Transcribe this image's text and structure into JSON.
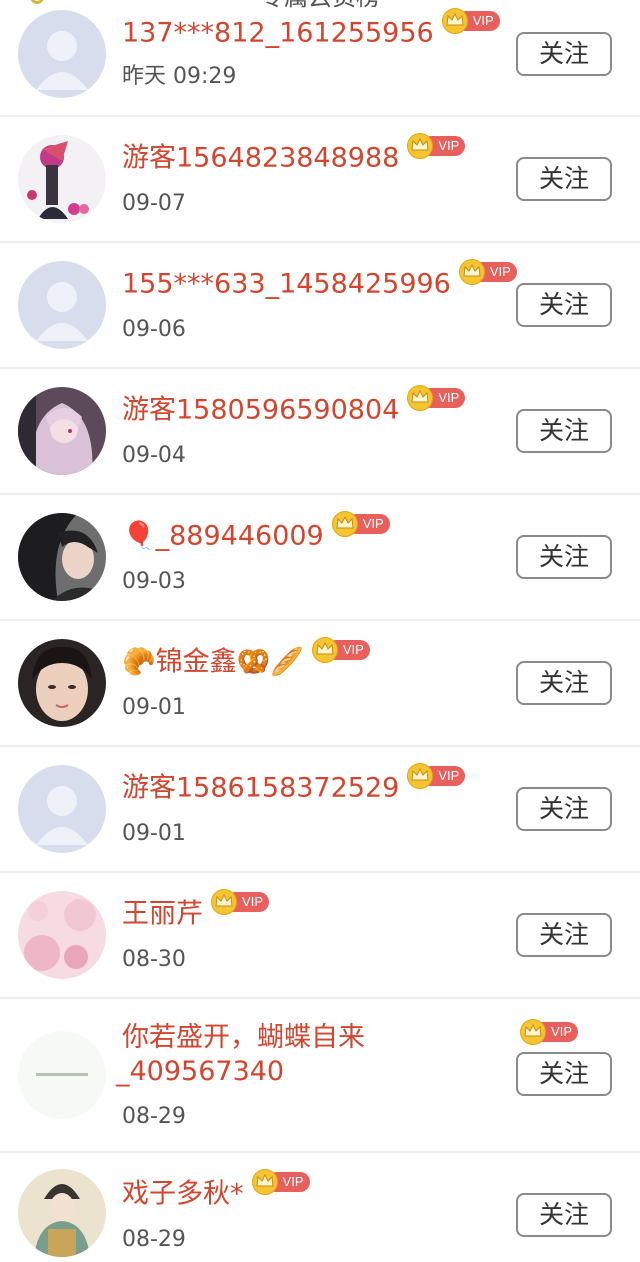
{
  "header": {
    "title": "专属云贡榜"
  },
  "follow_label": "关注",
  "vip_label": "VIP",
  "users": [
    {
      "name": "137***812_161255956",
      "date": "昨天 09:29",
      "avatar": "default-avatar"
    },
    {
      "name": "游客1564823848988",
      "date": "09-07",
      "avatar": "costume-character-avatar"
    },
    {
      "name": "155***633_1458425996",
      "date": "09-06",
      "avatar": "default-avatar"
    },
    {
      "name": "游客1580596590804",
      "date": "09-04",
      "avatar": "anime-girl-avatar"
    },
    {
      "name": "🎈_889446009",
      "date": "09-03",
      "avatar": "woman-photo-avatar"
    },
    {
      "name": "🥐锦金鑫🥨🥖",
      "date": "09-01",
      "avatar": "woman-portrait-avatar"
    },
    {
      "name": "游客1586158372529",
      "date": "09-01",
      "avatar": "default-avatar"
    },
    {
      "name": "王丽芹",
      "date": "08-30",
      "avatar": "pink-floral-avatar"
    },
    {
      "name_line1": "你若盛开，蝴蝶自来",
      "name_line2": "_409567340",
      "date": "08-29",
      "avatar": "text-logo-avatar"
    },
    {
      "name": "戏子多秋*",
      "date": "08-29",
      "avatar": "illustrated-lady-avatar"
    }
  ],
  "colors": {
    "name": "#d4452f",
    "date": "#555555",
    "vip_pill": "#e85f5b",
    "vip_crown": "#f4c531",
    "divider": "#eeeeee",
    "button_border": "#8a8a8a"
  }
}
